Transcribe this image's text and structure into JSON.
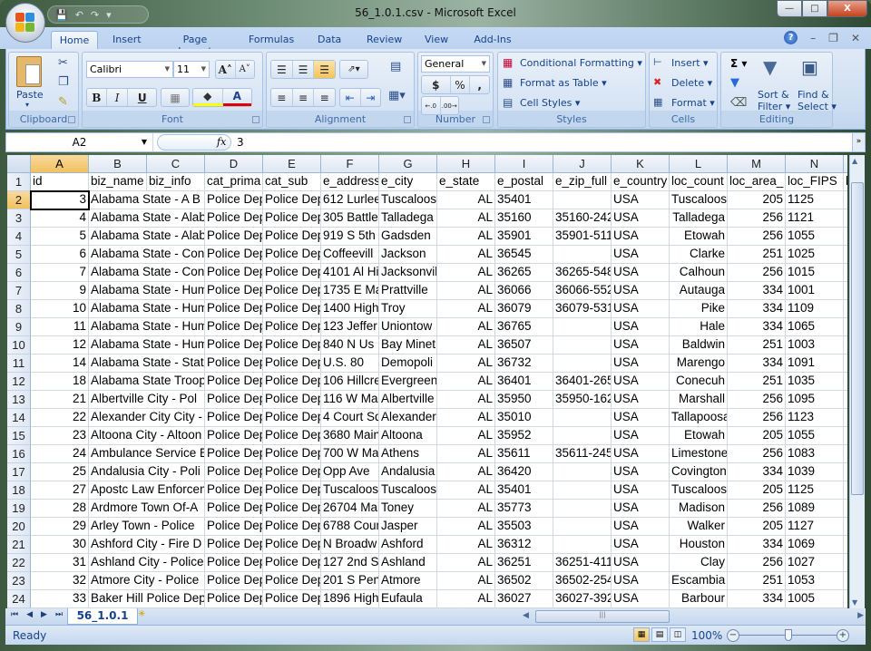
{
  "window": {
    "title": "56_1.0.1.csv - Microsoft Excel",
    "controls": {
      "minimize": "—",
      "restore": "□",
      "close": "X"
    }
  },
  "quick_access": {
    "save_icon": "💾",
    "undo_icon": "↶",
    "redo_icon": "↷",
    "customize_icon": "▾"
  },
  "ribbon": {
    "tabs": [
      "Home",
      "Insert",
      "Page Layout",
      "Formulas",
      "Data",
      "Review",
      "View",
      "Add-Ins"
    ],
    "active_tab": "Home",
    "help_icon": "?",
    "groups": {
      "clipboard": {
        "label": "Clipboard",
        "paste": "Paste",
        "paste_dd": "▾"
      },
      "font": {
        "label": "Font",
        "font_name": "Calibri",
        "font_size": "11",
        "bold": "B",
        "italic": "I",
        "underline": "U",
        "grow": "A˄",
        "shrink": "A˅",
        "border": "▦",
        "fill": "◆",
        "color": "A"
      },
      "alignment": {
        "label": "Alignment"
      },
      "number": {
        "label": "Number",
        "format": "General",
        "currency": "$",
        "percent": "%",
        "comma": ",",
        "inc_decimal": "←.0",
        "dec_decimal": ".00→"
      },
      "styles": {
        "label": "Styles",
        "conditional": "Conditional Formatting",
        "format_table": "Format as Table",
        "cell_styles": "Cell Styles"
      },
      "cells": {
        "label": "Cells",
        "insert": "Insert",
        "delete": "Delete",
        "format": "Format"
      },
      "editing": {
        "label": "Editing",
        "sum": "Σ",
        "sort_filter_1": "Sort &",
        "sort_filter_2": "Filter",
        "find_select_1": "Find &",
        "find_select_2": "Select"
      }
    }
  },
  "formula_bar": {
    "name_box": "A2",
    "fx": "fx",
    "value": "3"
  },
  "sheet": {
    "columns": [
      "A",
      "B",
      "C",
      "D",
      "E",
      "F",
      "G",
      "H",
      "I",
      "J",
      "K",
      "L",
      "M",
      "N"
    ],
    "selected_column": "A",
    "selected_row": 2,
    "headers": [
      "id",
      "biz_name",
      "biz_info",
      "cat_prima",
      "cat_sub",
      "e_address",
      "e_city",
      "e_state",
      "e_postal",
      "e_zip_full",
      "e_country",
      "loc_count",
      "loc_area_",
      "loc_FIPS"
    ],
    "rows": [
      [
        "3",
        "Alabama State - A B C",
        "Police Dep",
        "Police Dep",
        "612 Lurlee",
        "Tuscaloos",
        "AL",
        "35401",
        "",
        "USA",
        "Tuscaloos",
        "205",
        "1125"
      ],
      [
        "4",
        "Alabama State - Alab",
        "Police Dep",
        "Police Dep",
        "305 Battle",
        "Talladega",
        "AL",
        "35160",
        "35160-242",
        "USA",
        "Talladega",
        "256",
        "1121"
      ],
      [
        "5",
        "Alabama State - Alab",
        "Police Dep",
        "Police Dep",
        "919 S 5th S",
        "Gadsden",
        "AL",
        "35901",
        "35901-511",
        "USA",
        "Etowah",
        "256",
        "1055"
      ],
      [
        "6",
        "Alabama State - Con",
        "Police Dep",
        "Police Dep",
        "Coffeevill",
        "Jackson",
        "AL",
        "36545",
        "",
        "USA",
        "Clarke",
        "251",
        "1025"
      ],
      [
        "7",
        "Alabama State - Con",
        "Police Dep",
        "Police Dep",
        "4101 Al Hi",
        "Jacksonvil",
        "AL",
        "36265",
        "36265-548",
        "USA",
        "Calhoun",
        "256",
        "1015"
      ],
      [
        "9",
        "Alabama State - Hum",
        "Police Dep",
        "Police Dep",
        "1735 E Ma",
        "Prattville",
        "AL",
        "36066",
        "36066-552",
        "USA",
        "Autauga",
        "334",
        "1001"
      ],
      [
        "10",
        "Alabama State - Hum",
        "Police Dep",
        "Police Dep",
        "1400 Highw",
        "Troy",
        "AL",
        "36079",
        "36079-531",
        "USA",
        "Pike",
        "334",
        "1109"
      ],
      [
        "11",
        "Alabama State - Hum",
        "Police Dep",
        "Police Dep",
        "123 Jeffer",
        "Uniontow",
        "AL",
        "36765",
        "",
        "USA",
        "Hale",
        "334",
        "1065"
      ],
      [
        "12",
        "Alabama State - Hum",
        "Police Dep",
        "Police Dep",
        "840 N Us H",
        "Bay Minet",
        "AL",
        "36507",
        "",
        "USA",
        "Baldwin",
        "251",
        "1003"
      ],
      [
        "14",
        "Alabama State - Stat",
        "Police Dep",
        "Police Dep",
        "U.S. 80",
        "Demopoli",
        "AL",
        "36732",
        "",
        "USA",
        "Marengo",
        "334",
        "1091"
      ],
      [
        "18",
        "Alabama State Troop",
        "Police Dep",
        "Police Dep",
        "106 Hillcre",
        "Evergreen",
        "AL",
        "36401",
        "36401-265",
        "USA",
        "Conecuh",
        "251",
        "1035"
      ],
      [
        "21",
        "Albertville City - Pol",
        "Police Dep",
        "Police Dep",
        "116 W Mai",
        "Albertville",
        "AL",
        "35950",
        "35950-162",
        "USA",
        "Marshall",
        "256",
        "1095"
      ],
      [
        "22",
        "Alexander City City -",
        "Police Dep",
        "Police Dep",
        "4 Court Sq",
        "Alexander",
        "AL",
        "35010",
        "",
        "USA",
        "Tallapoosa",
        "256",
        "1123"
      ],
      [
        "23",
        "Altoona City - Altoon",
        "Police Dep",
        "Police Dep",
        "3680 Main",
        "Altoona",
        "AL",
        "35952",
        "",
        "USA",
        "Etowah",
        "205",
        "1055"
      ],
      [
        "24",
        "Ambulance Service E",
        "Police Dep",
        "Police Dep",
        "700 W Mai",
        "Athens",
        "AL",
        "35611",
        "35611-245",
        "USA",
        "Limestone",
        "256",
        "1083"
      ],
      [
        "25",
        "Andalusia City - Poli",
        "Police Dep",
        "Police Dep",
        "Opp Ave",
        "Andalusia",
        "AL",
        "36420",
        "",
        "USA",
        "Covington",
        "334",
        "1039"
      ],
      [
        "27",
        "Apostc Law Enforcem",
        "Police Dep",
        "Police Dep",
        "Tuscaloos",
        "Tuscaloos",
        "AL",
        "35401",
        "",
        "USA",
        "Tuscaloos",
        "205",
        "1125"
      ],
      [
        "28",
        "Ardmore Town Of-A",
        "Police Dep",
        "Police Dep",
        "26704 Mai",
        "Toney",
        "AL",
        "35773",
        "",
        "USA",
        "Madison",
        "256",
        "1089"
      ],
      [
        "29",
        "Arley Town - Police",
        "Police Dep",
        "Police Dep",
        "6788 Coun",
        "Jasper",
        "AL",
        "35503",
        "",
        "USA",
        "Walker",
        "205",
        "1127"
      ],
      [
        "30",
        "Ashford City - Fire D",
        "Police Dep",
        "Police Dep",
        "N Broadw",
        "Ashford",
        "AL",
        "36312",
        "",
        "USA",
        "Houston",
        "334",
        "1069"
      ],
      [
        "31",
        "Ashland City - Police",
        "Police Dep",
        "Police Dep",
        "127 2nd St",
        "Ashland",
        "AL",
        "36251",
        "36251-411",
        "USA",
        "Clay",
        "256",
        "1027"
      ],
      [
        "32",
        "Atmore City - Police",
        "Police Dep",
        "Police Dep",
        "201 S Pens",
        "Atmore",
        "AL",
        "36502",
        "36502-254",
        "USA",
        "Escambia",
        "251",
        "1053"
      ],
      [
        "33",
        "Baker Hill Police Dep",
        "Police Dep",
        "Police Dep",
        "1896 High",
        "Eufaula",
        "AL",
        "36027",
        "36027-392",
        "USA",
        "Barbour",
        "334",
        "1005"
      ]
    ]
  },
  "sheet_tabs": {
    "nav": [
      "⏮",
      "◀",
      "▶",
      "⏭"
    ],
    "active": "56_1.0.1",
    "new_sheet_icon": "✳"
  },
  "status": {
    "text": "Ready",
    "zoom": "100%",
    "zoom_minus": "−",
    "zoom_plus": "+",
    "zoom_level_percent": 100
  }
}
